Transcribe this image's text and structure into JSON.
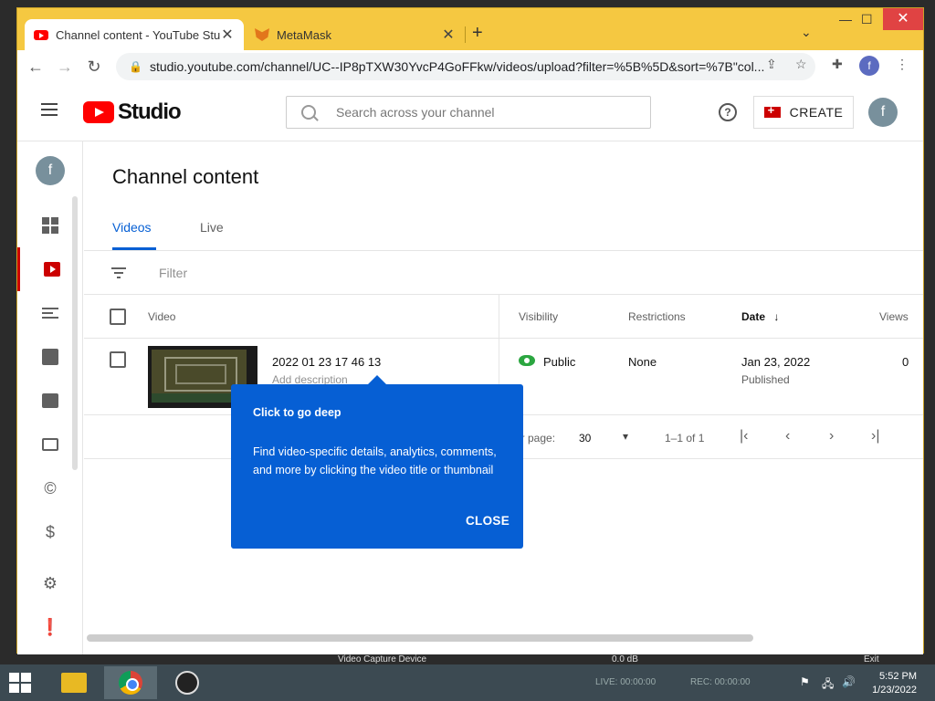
{
  "browser": {
    "tabs": [
      {
        "title": "Channel content - YouTube Studio",
        "active": true
      },
      {
        "title": "MetaMask",
        "active": false
      }
    ],
    "new_tab": "+",
    "tab_close": "✕",
    "url": "studio.youtube.com/channel/UC--IP8pTXW30YvcP4GoFFkw/videos/upload?filter=%5B%5D&sort=%7B\"col...",
    "profile_initial": "f",
    "window_minimize": "—",
    "window_maximize": "☐",
    "window_close": "✕"
  },
  "studio": {
    "logo_text": "Studio",
    "search_placeholder": "Search across your channel",
    "help_label": "?",
    "create_label": "CREATE",
    "avatar_initial": "f",
    "page_title": "Channel content",
    "tabs": [
      "Videos",
      "Live"
    ],
    "filter_placeholder": "Filter",
    "columns": {
      "video": "Video",
      "visibility": "Visibility",
      "restrictions": "Restrictions",
      "date": "Date",
      "date_sort": "↓",
      "views": "Views"
    },
    "rows": [
      {
        "title": "2022 01 23 17 46 13",
        "description": "Add description",
        "visibility": "Public",
        "restrictions": "None",
        "date": "Jan 23, 2022",
        "date_status": "Published",
        "views": "0"
      }
    ],
    "pagination": {
      "rows_per_page_label": "er page:",
      "rows_per_page": "30",
      "range": "1–1 of 1"
    }
  },
  "tooltip": {
    "title": "Click to go deep",
    "body": "Find video-specific details, analytics, comments, and more by clicking the video title or thumbnail",
    "close_label": "CLOSE"
  },
  "obs": {
    "video_capture": "Video Capture Device",
    "db": "0.0 dB",
    "exit": "Exit"
  },
  "taskbar": {
    "live": "LIVE: 00:00:00",
    "rec": "REC: 00:00:00",
    "time": "5:52 PM",
    "date": "1/23/2022"
  },
  "colors": {
    "accent_blue": "#065fd4",
    "brand_red": "#ff0000",
    "public_green": "#2ba640",
    "window_frame": "#f1c40f"
  }
}
